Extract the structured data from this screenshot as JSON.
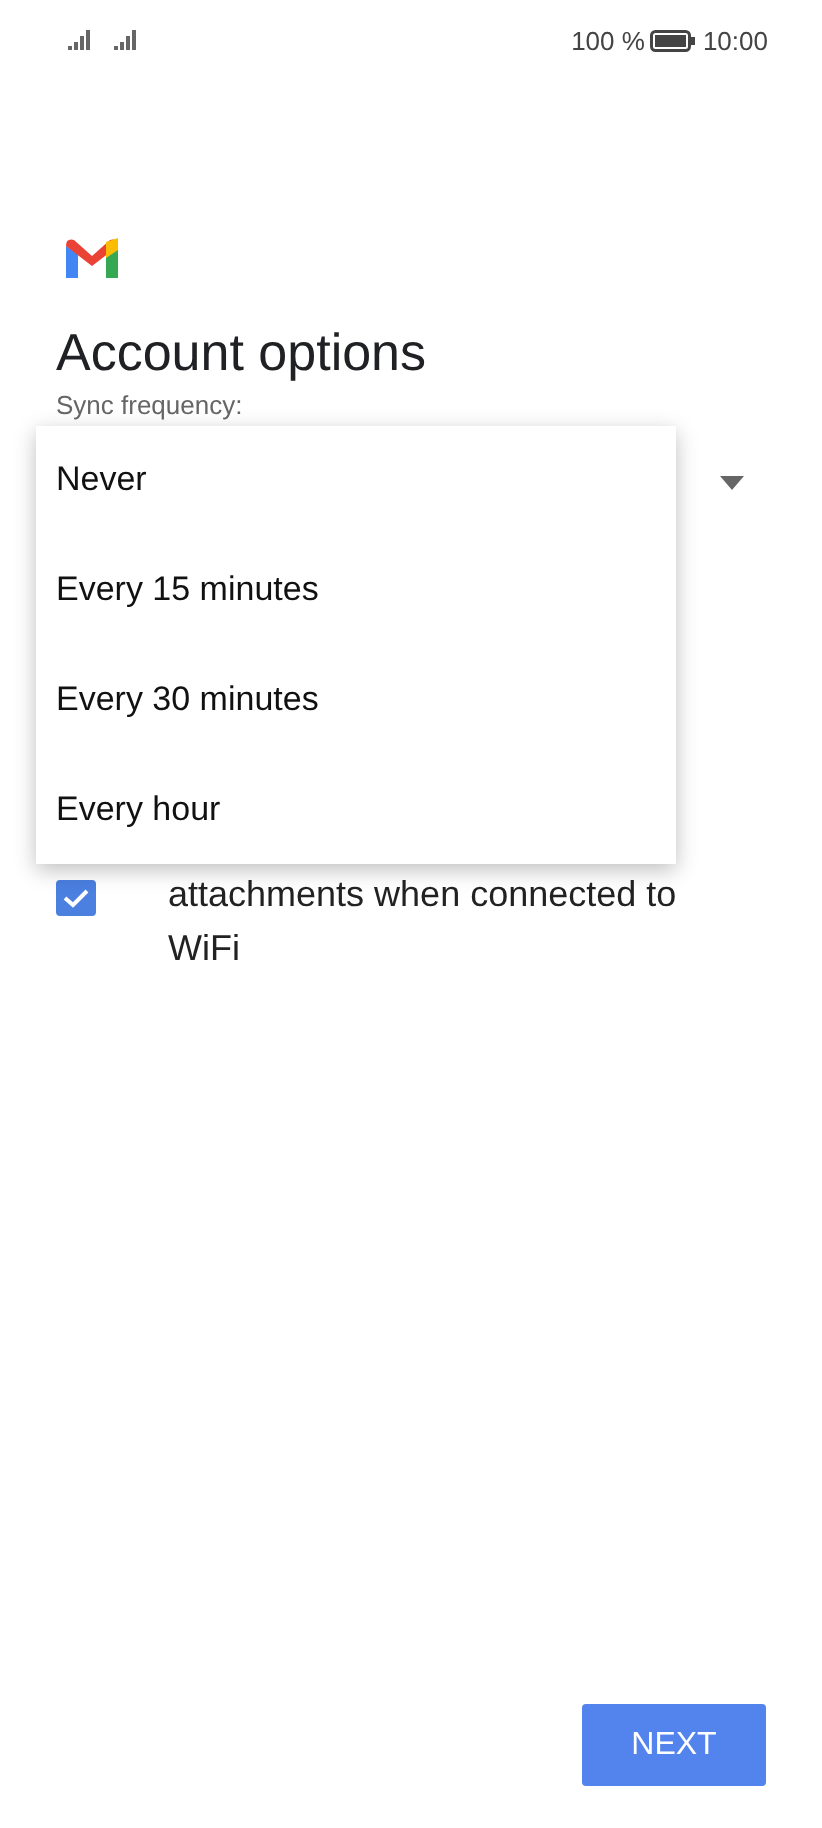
{
  "status_bar": {
    "battery": "100 %",
    "time": "10:00"
  },
  "title": "Account options",
  "sync_frequency": {
    "label": "Sync frequency:",
    "menu": [
      {
        "label": "Never"
      },
      {
        "label": "Every 15 minutes"
      },
      {
        "label": "Every 30 minutes"
      },
      {
        "label": "Every hour"
      }
    ]
  },
  "attachments_option": {
    "checked": true,
    "lines": [
      "attachments when connected to",
      "WiFi"
    ]
  },
  "next_button": "NEXT"
}
